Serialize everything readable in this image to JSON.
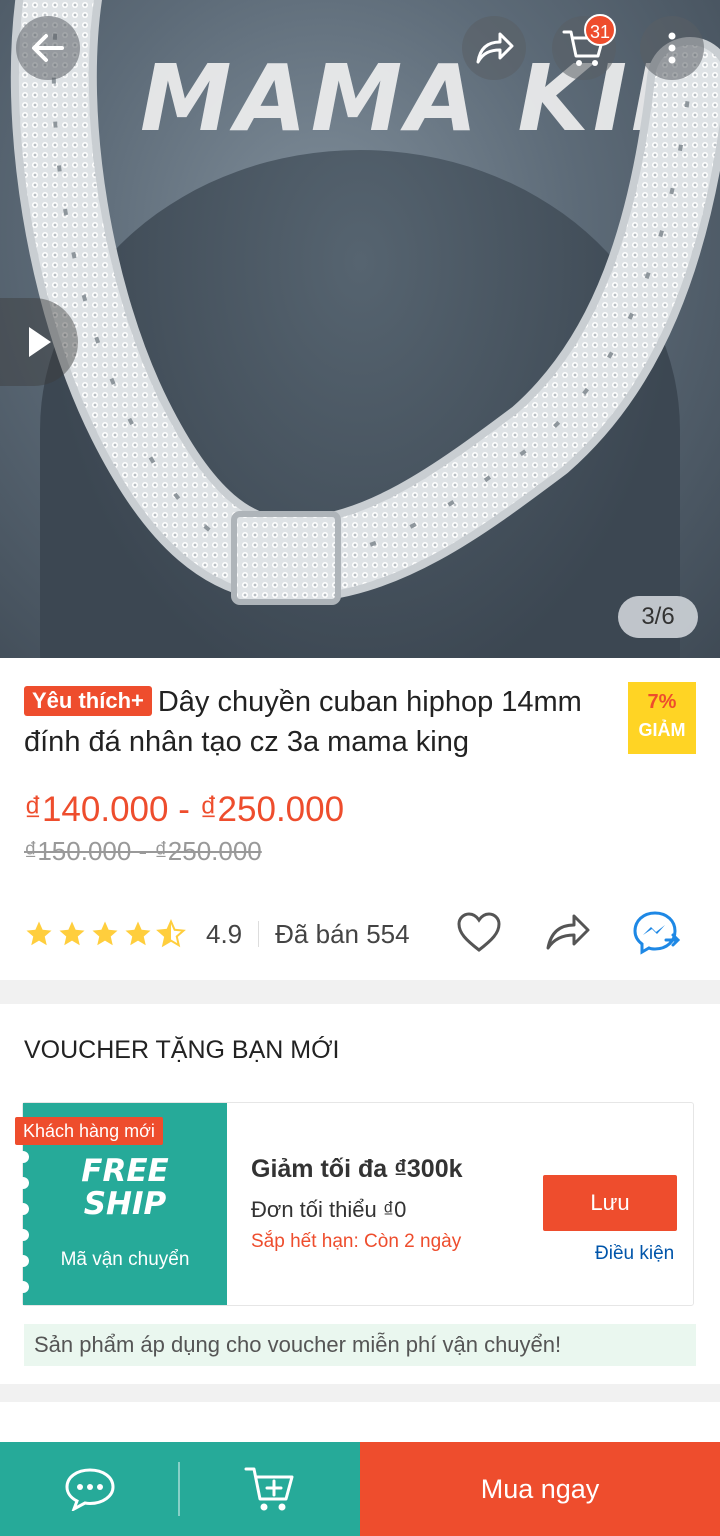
{
  "colors": {
    "accent": "#ee4d2d",
    "teal": "#26aa99",
    "star": "#ffce3d",
    "link": "#0055aa"
  },
  "header": {
    "cart_count": "31",
    "icons": [
      "back-arrow-icon",
      "share-icon",
      "cart-icon",
      "more-vertical-icon"
    ]
  },
  "gallery": {
    "watermark": "MAMA KING",
    "counter": "3/6"
  },
  "product": {
    "badge": "Yêu thích+",
    "title": "Dây chuyền cuban hiphop 14mm đính đá nhân tạo cz 3a mama king",
    "discount_percent": "7%",
    "discount_label": "GIẢM",
    "price": "₫140.000 - ₫250.000",
    "original_price": "₫150.000 - ₫250.000",
    "rating": "4.9",
    "rating_stars": 4.9,
    "sold": "Đã bán 554"
  },
  "voucher": {
    "heading": "VOUCHER TẶNG BẠN MỚI",
    "badge": "Khách hàng mới",
    "free_ship_line1": "FREE",
    "free_ship_line2": "SHIP",
    "type": "Mã vận chuyển",
    "title": "Giảm tối đa ₫300k",
    "min_order": "Đơn tối thiểu ₫0",
    "expiry": "Sắp hết hạn: Còn 2 ngày",
    "save_label": "Lưu",
    "condition_label": "Điều kiện",
    "note": "Sản phẩm áp dụng cho voucher miễn phí vận chuyển!"
  },
  "bottom_bar": {
    "buy_now_label": "Mua ngay"
  }
}
